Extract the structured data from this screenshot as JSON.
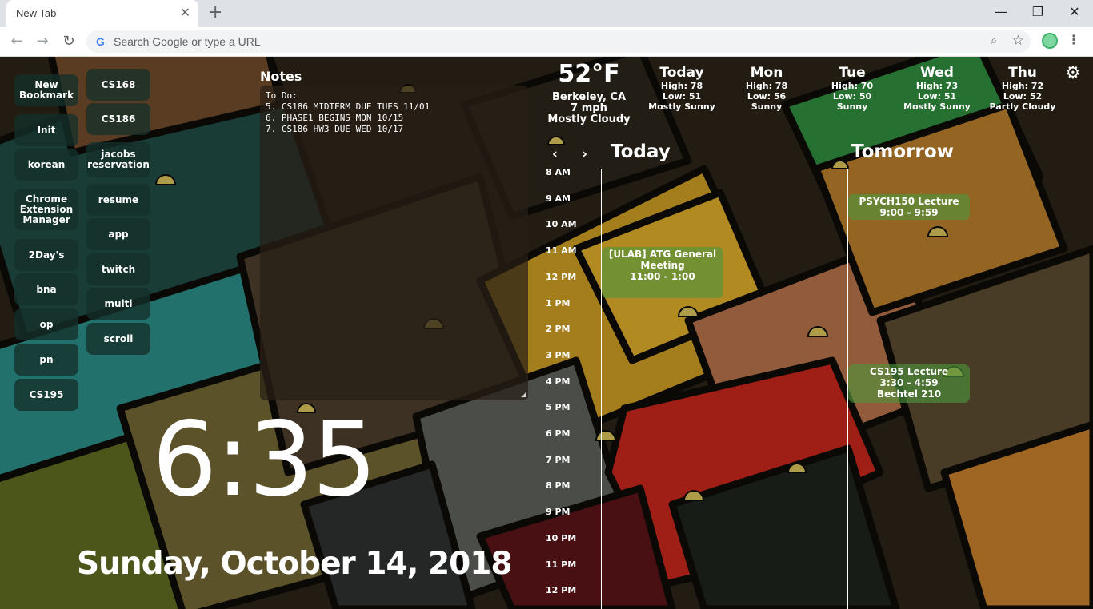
{
  "browser": {
    "tab_title": "New Tab",
    "tab_close": "✕",
    "new_tab": "+",
    "window_controls": {
      "minimize": "—",
      "restore": "❐",
      "close": "✕"
    },
    "omnibox_placeholder": "Search Google or type a URL",
    "nav": {
      "back": "←",
      "forward": "→",
      "reload": "↻"
    },
    "zoom_icon": "⌕",
    "star_icon": "☆",
    "menu": "⋮",
    "g_logo": "G"
  },
  "bookmarks": {
    "col1": [
      "New Bookmark",
      "Init",
      "korean",
      "Chrome Extension Manager",
      "2Day's",
      "bna",
      "op",
      "pn",
      "CS195"
    ],
    "col2": [
      "CS168",
      "CS186",
      "jacobs reservation",
      "resume",
      "app",
      "twitch",
      "multi",
      "scroll"
    ]
  },
  "notes": {
    "title": "Notes",
    "text": "To Do:\n5. CS186 MIDTERM DUE TUES 11/01\n6. PHASE1 BEGINS MON 10/15\n7. CS186 HW3 DUE WED 10/17",
    "grip": "◢"
  },
  "clock": {
    "time": "6:35",
    "date": "Sunday, October 14, 2018"
  },
  "weather": {
    "current": {
      "temp": "52°F",
      "location": "Berkeley, CA",
      "wind": "7 mph",
      "condition": "Mostly Cloudy"
    },
    "forecast": [
      {
        "day": "Today",
        "high": "High: 78",
        "low": "Low: 51",
        "condition": "Mostly Sunny"
      },
      {
        "day": "Mon",
        "high": "High: 78",
        "low": "Low: 56",
        "condition": "Sunny"
      },
      {
        "day": "Tue",
        "high": "High: 70",
        "low": "Low: 50",
        "condition": "Sunny"
      },
      {
        "day": "Wed",
        "high": "High: 73",
        "low": "Low: 51",
        "condition": "Mostly Sunny"
      },
      {
        "day": "Thu",
        "high": "High: 72",
        "low": "Low: 52",
        "condition": "Partly Cloudy"
      }
    ],
    "settings_icon": "⚙"
  },
  "calendar": {
    "prev": "‹",
    "next": "›",
    "today_label": "Today",
    "tomorrow_label": "Tomorrow",
    "hours": [
      "8 AM",
      "9 AM",
      "10 AM",
      "11 AM",
      "12 PM",
      "1 PM",
      "2 PM",
      "3 PM",
      "4 PM",
      "5 PM",
      "6 PM",
      "7 PM",
      "8 PM",
      "9 PM",
      "10 PM",
      "11 PM",
      "12 PM"
    ],
    "events": [
      {
        "title": "[ULAB] ATG General Meeting",
        "time": "11:00 - 1:00",
        "location": ""
      },
      {
        "title": "PSYCH150 Lecture",
        "time": "9:00 - 9:59",
        "location": ""
      },
      {
        "title": "CS195 Lecture",
        "time": "3:30 - 4:59",
        "location": "Bechtel 210"
      }
    ]
  },
  "colors": {
    "event_bg": "#4e963c",
    "bookmark_bg": "#14302a",
    "notes_bg": "#282016"
  }
}
